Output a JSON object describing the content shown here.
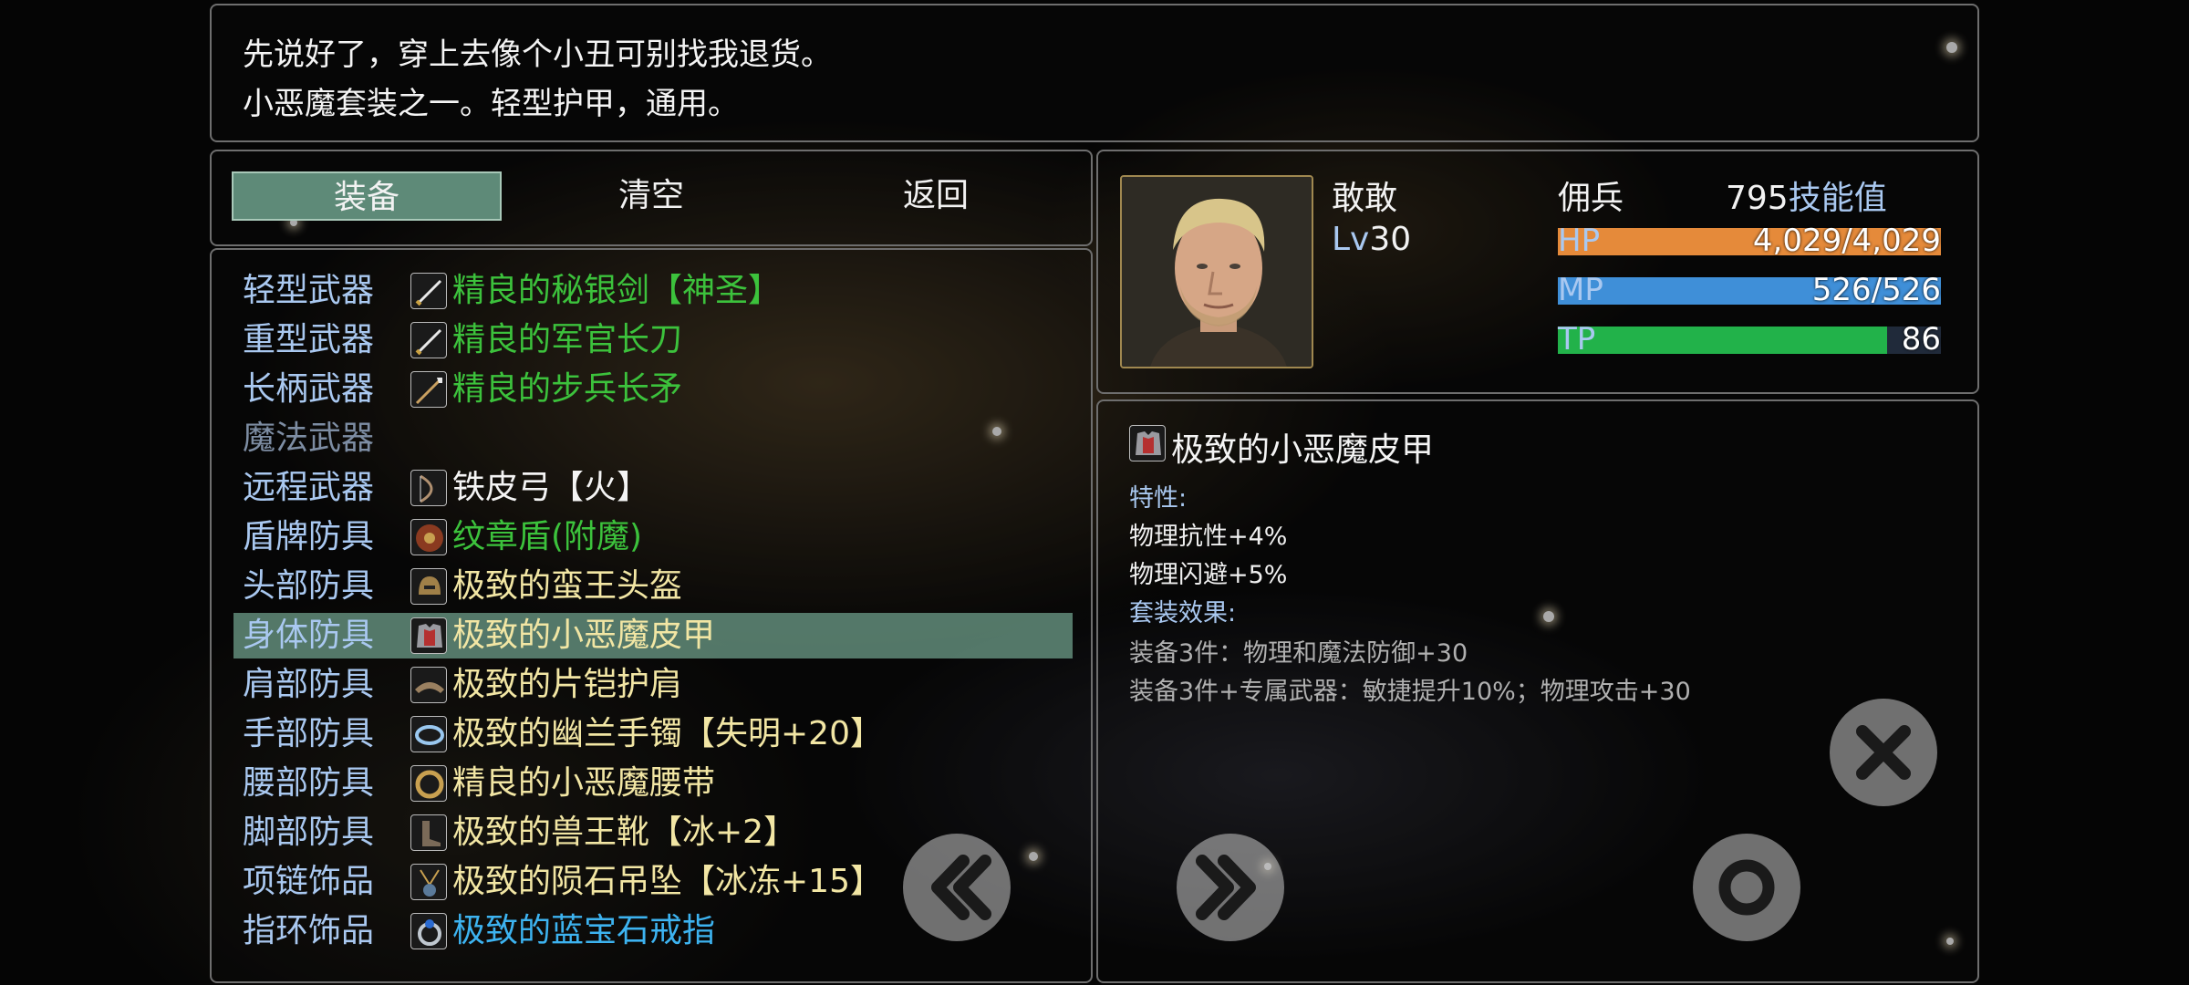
{
  "description": {
    "line1": "先说好了，穿上去像个小丑可别找我退货。",
    "line2": "小恶魔套装之一。轻型护甲，通用。"
  },
  "commands": {
    "equip": "装备",
    "clear": "清空",
    "back": "返回"
  },
  "slots": [
    {
      "label": "轻型武器",
      "item": "精良的秘银剑【神圣】",
      "quality": "green",
      "icon": "sword-icon"
    },
    {
      "label": "重型武器",
      "item": "精良的军官长刀",
      "quality": "green",
      "icon": "sword-icon"
    },
    {
      "label": "长柄武器",
      "item": "精良的步兵长矛",
      "quality": "green",
      "icon": "spear-icon"
    },
    {
      "label": "魔法武器",
      "item": "",
      "quality": "none",
      "icon": ""
    },
    {
      "label": "远程武器",
      "item": "铁皮弓【火】",
      "quality": "white",
      "icon": "bow-icon"
    },
    {
      "label": "盾牌防具",
      "item": "纹章盾(附魔)",
      "quality": "green",
      "icon": "shield-icon"
    },
    {
      "label": "头部防具",
      "item": "极致的蛮王头盔",
      "quality": "yellow",
      "icon": "helmet-icon"
    },
    {
      "label": "身体防具",
      "item": "极致的小恶魔皮甲",
      "quality": "yellow",
      "icon": "armor-icon"
    },
    {
      "label": "肩部防具",
      "item": "极致的片铠护肩",
      "quality": "yellow",
      "icon": "pauldron-icon"
    },
    {
      "label": "手部防具",
      "item": "极致的幽兰手镯【失明+20】",
      "quality": "yellow",
      "icon": "bracelet-icon"
    },
    {
      "label": "腰部防具",
      "item": "精良的小恶魔腰带",
      "quality": "yellow",
      "icon": "belt-icon"
    },
    {
      "label": "脚部防具",
      "item": "极致的兽王靴【冰+2】",
      "quality": "yellow",
      "icon": "boots-icon"
    },
    {
      "label": "项链饰品",
      "item": "极致的陨石吊坠【冰冻+15】",
      "quality": "yellow",
      "icon": "pendant-icon"
    },
    {
      "label": "指环饰品",
      "item": "极致的蓝宝石戒指",
      "quality": "blue",
      "icon": "ring-icon"
    }
  ],
  "selected_slot": 7,
  "character": {
    "name": "敢敢",
    "level_prefix": "Lv",
    "level": "30",
    "class": "佣兵",
    "skill_points": "795",
    "skill_label": "技能值",
    "hp_label": "HP",
    "hp_value": "4,029/4,029",
    "hp_fraction": 1.0,
    "mp_label": "MP",
    "mp_value": "526/526",
    "mp_fraction": 1.0,
    "tp_label": "TP",
    "tp_value": "86",
    "tp_fraction": 0.86
  },
  "detail": {
    "title": "极致的小恶魔皮甲",
    "traits_header": "特性:",
    "trait1": "物理抗性+4%",
    "trait2": "物理闪避+5%",
    "set_header": "套装效果:",
    "set1": "装备3件：物理和魔法防御+30",
    "set2": "装备3件+专属武器：敏捷提升10%；物理攻击+30"
  },
  "colors": {
    "hp": "#e58a3a",
    "mp": "#3f8fd8",
    "tp": "#22b24a",
    "selection": "#5e8a78",
    "label_blue": "#a9c8f0",
    "quality_green": "#3cc23c",
    "quality_yellow": "#f2e6a4",
    "quality_blue": "#3db3f0"
  }
}
